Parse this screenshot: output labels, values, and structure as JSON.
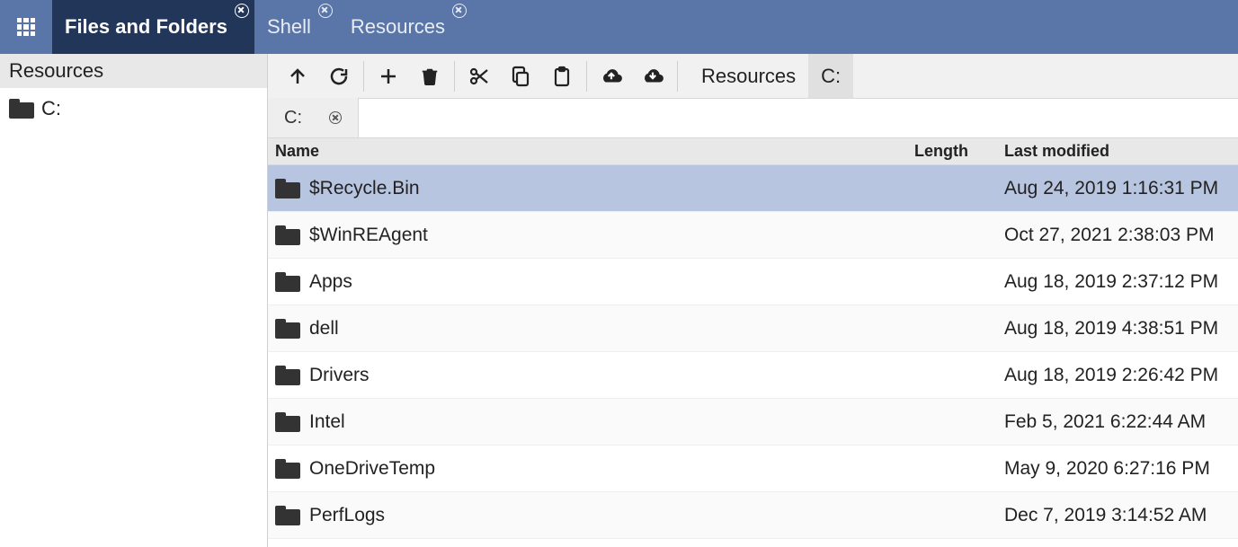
{
  "topbar": {
    "tabs": [
      {
        "label": "Files and Folders",
        "closable": true,
        "active": true
      },
      {
        "label": "Shell",
        "closable": true,
        "active": false
      },
      {
        "label": "Resources",
        "closable": true,
        "active": false
      }
    ]
  },
  "sidebar": {
    "title": "Resources",
    "items": [
      {
        "label": "C:"
      }
    ]
  },
  "toolbar": {
    "breadcrumb": [
      {
        "label": "Resources",
        "active": false
      },
      {
        "label": "C:",
        "active": true
      }
    ]
  },
  "pathtabs": [
    {
      "label": "C:"
    }
  ],
  "table": {
    "headers": {
      "name": "Name",
      "length": "Length",
      "modified": "Last modified"
    },
    "rows": [
      {
        "name": "$Recycle.Bin",
        "length": "",
        "modified": "Aug 24, 2019 1:16:31 PM",
        "selected": true
      },
      {
        "name": "$WinREAgent",
        "length": "",
        "modified": "Oct 27, 2021 2:38:03 PM",
        "selected": false
      },
      {
        "name": "Apps",
        "length": "",
        "modified": "Aug 18, 2019 2:37:12 PM",
        "selected": false
      },
      {
        "name": "dell",
        "length": "",
        "modified": "Aug 18, 2019 4:38:51 PM",
        "selected": false
      },
      {
        "name": "Drivers",
        "length": "",
        "modified": "Aug 18, 2019 2:26:42 PM",
        "selected": false
      },
      {
        "name": "Intel",
        "length": "",
        "modified": "Feb 5, 2021 6:22:44 AM",
        "selected": false
      },
      {
        "name": "OneDriveTemp",
        "length": "",
        "modified": "May 9, 2020 6:27:16 PM",
        "selected": false
      },
      {
        "name": "PerfLogs",
        "length": "",
        "modified": "Dec 7, 2019 3:14:52 AM",
        "selected": false
      }
    ]
  }
}
